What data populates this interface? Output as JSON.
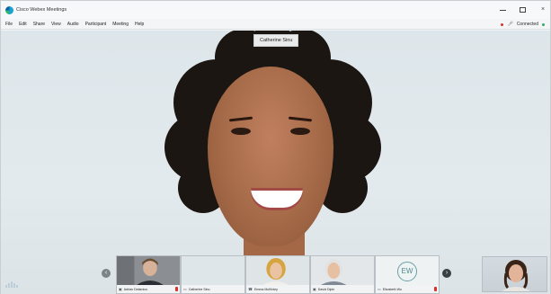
{
  "window": {
    "title": "Cisco Webex Meetings",
    "controls": {
      "close": "×"
    }
  },
  "menubar": {
    "items": [
      "File",
      "Edit",
      "Share",
      "View",
      "Audio",
      "Participant",
      "Meeting",
      "Help"
    ],
    "status_text": "Connected"
  },
  "stage": {
    "active_speaker": "Catherine Sinu"
  },
  "thumbnails": [
    {
      "name": "Adrian Delamico",
      "icon": "video-icon",
      "muted": true
    },
    {
      "name": "Catherine Sinu",
      "icon": "laptop-icon",
      "muted": false
    },
    {
      "name": "Emma McKinley",
      "icon": "phone-icon",
      "muted": false
    },
    {
      "name": "David Dipin",
      "icon": "video-icon",
      "muted": false
    },
    {
      "name": "Elizabeth Wu",
      "icon": "laptop-icon",
      "muted": true,
      "initials": "EW"
    }
  ],
  "nav": {
    "prev": "‹",
    "next": "›"
  },
  "colors": {
    "accent": "#1ba0d8",
    "recording": "#d9312b",
    "connected": "#3aa56b"
  }
}
